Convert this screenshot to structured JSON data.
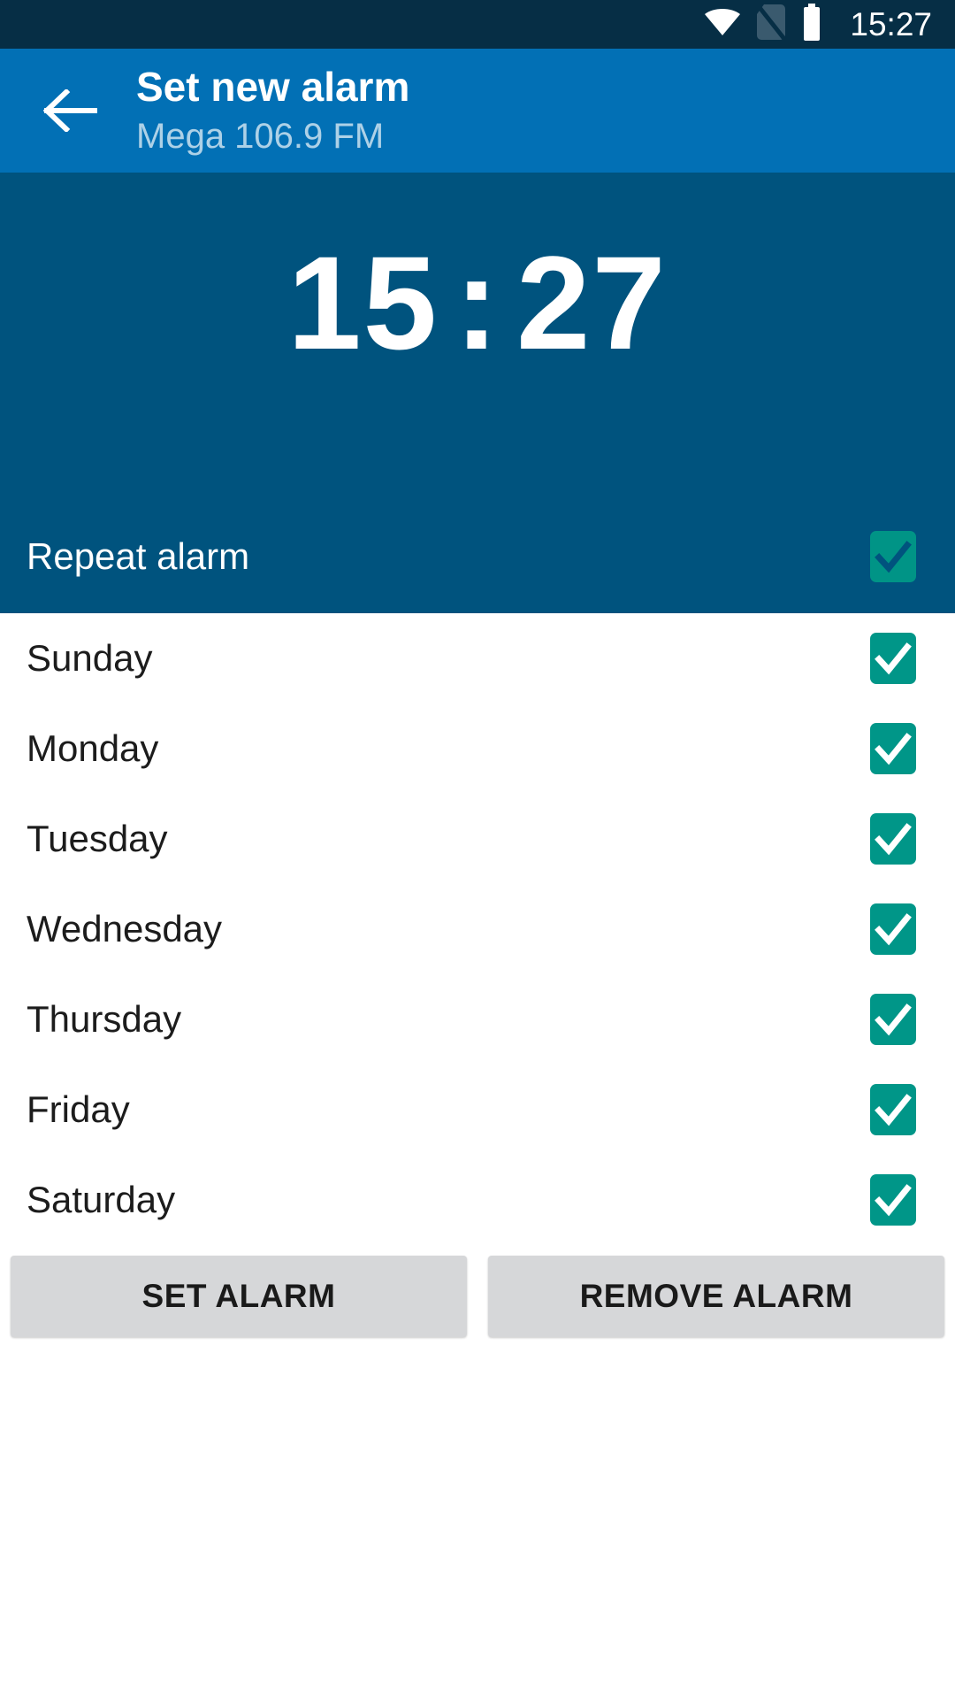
{
  "status_bar": {
    "time": "15:27",
    "icons": [
      {
        "name": "wifi-icon",
        "glyph": "wifi"
      },
      {
        "name": "no-sim-card-icon",
        "glyph": "no-sim"
      },
      {
        "name": "battery-icon",
        "glyph": "battery-full"
      }
    ],
    "background_color": "#062E45"
  },
  "app_bar": {
    "back_icon": "back-arrow-icon",
    "title": "Set new alarm",
    "subtitle": "Mega 106.9 FM",
    "background_color": "#0270B5"
  },
  "clock": {
    "hours": "15",
    "separator": ":",
    "minutes": "27",
    "background_color": "#00537E",
    "text_color": "#FFFFFF"
  },
  "repeat": {
    "label": "Repeat alarm",
    "checked": true,
    "checkbox_color": "#009486",
    "check_color": "#00537E"
  },
  "days": {
    "checkbox_color": "#009688",
    "check_color": "#FFFFFF",
    "items": [
      {
        "label": "Sunday",
        "checked": true
      },
      {
        "label": "Monday",
        "checked": true
      },
      {
        "label": "Tuesday",
        "checked": true
      },
      {
        "label": "Wednesday",
        "checked": true
      },
      {
        "label": "Thursday",
        "checked": true
      },
      {
        "label": "Friday",
        "checked": true
      },
      {
        "label": "Saturday",
        "checked": true
      }
    ]
  },
  "actions": {
    "set_alarm_label": "SET ALARM",
    "remove_alarm_label": "REMOVE ALARM",
    "button_color": "#D6D7D9"
  }
}
